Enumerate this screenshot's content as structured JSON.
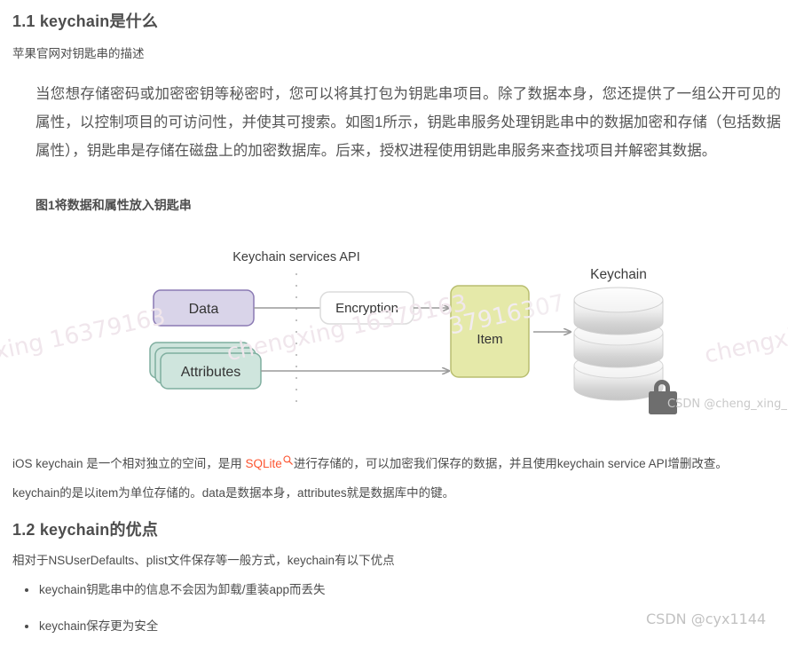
{
  "document": {
    "sections": [
      {
        "heading": "1.1 keychain是什么",
        "subtitle": "苹果官网对钥匙串的描述",
        "quote": "当您想存储密码或加密密钥等秘密时，您可以将其打包为钥匙串项目。除了数据本身，您还提供了一组公开可见的属性，以控制项目的可访问性，并使其可搜索。如图1所示，钥匙串服务处理钥匙串中的数据加密和存储（包括数据属性），钥匙串是存储在磁盘上的加密数据库。后来，授权进程使用钥匙串服务来查找项目并解密其数据。",
        "figure_caption": "图1将数据和属性放入钥匙串"
      },
      {
        "heading": "1.2 keychain的优点",
        "intro": "相对于NSUserDefaults、plist文件保存等一般方式，keychain有以下优点",
        "bullets": [
          "keychain钥匙串中的信息不会因为卸载/重装app而丢失",
          "keychain保存更为安全"
        ]
      }
    ],
    "paragraphs": {
      "ios_before_link": "iOS keychain 是一个相对独立的空间，是用 ",
      "ios_link": "SQLite",
      "ios_after_link": "进行存储的，可以加密我们保存的数据，并且使用keychain service API增删改查。",
      "item_line": "keychain的是以item为单位存储的。data是数据本身，attributes就是数据库中的键。"
    }
  },
  "figure": {
    "title": "Keychain services API",
    "nodes": {
      "data": "Data",
      "attributes": "Attributes",
      "encryption": "Encryption",
      "item": "Item",
      "keychain": "Keychain"
    },
    "icons": {
      "lock": "lock-icon",
      "database": "database-cylinder-icon",
      "arrow": "arrow-right-icon",
      "divider": "vertical-dotted-divider"
    },
    "colors": {
      "data_fill": "#d9d4e9",
      "data_stroke": "#8a79b3",
      "attributes_fill": "#cfe5dd",
      "attributes_stroke": "#7fae9f",
      "item_fill": "#e5e9a9",
      "item_stroke": "#b9be70",
      "encryption_fill": "#ffffff",
      "encryption_stroke": "#dcdcdc",
      "cylinder_light": "#fbfbfb",
      "cylinder_dark": "#c9c9c9",
      "arrow": "#9a9a9a",
      "lock": "#6e6e6e"
    }
  },
  "watermarks": {
    "left": "xing 16379163",
    "middle": "chengxing 16379163",
    "item": "37916307",
    "right": "chengxing",
    "figure_tag": "CSDN @cheng_xing_",
    "page_tag": "CSDN @cyx1144"
  },
  "link": {
    "icon": "search-icon",
    "color": "#fc5531"
  }
}
